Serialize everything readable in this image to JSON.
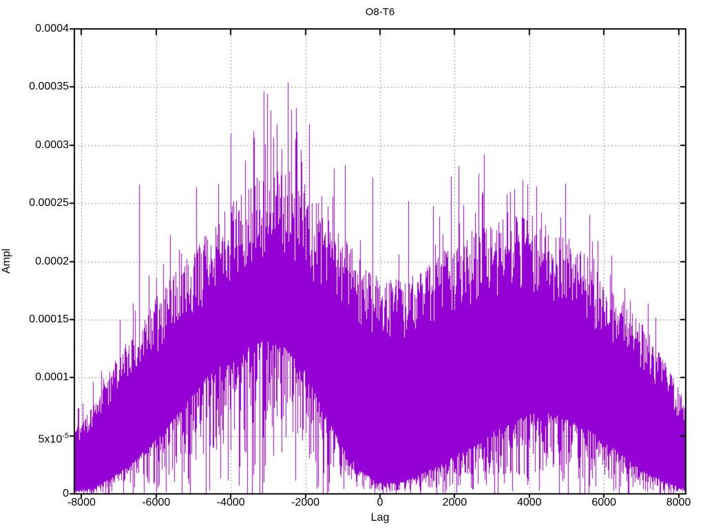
{
  "window": {
    "background": "#ffffff",
    "foreground": "#000000"
  },
  "chart_data": {
    "type": "line",
    "title": "O8-T6",
    "xlabel": "Lag",
    "ylabel": "Ampl",
    "xlim": [
      -8192,
      8192
    ],
    "ylim": [
      0,
      0.0004
    ],
    "grid": true,
    "legend": "none",
    "grid_color": "#909090",
    "axis_color": "#000000",
    "x_ticks": [
      {
        "value": -8000,
        "label": "-8000"
      },
      {
        "value": -6000,
        "label": "-6000"
      },
      {
        "value": -4000,
        "label": "-4000"
      },
      {
        "value": -2000,
        "label": "-2000"
      },
      {
        "value": 0,
        "label": "0"
      },
      {
        "value": 2000,
        "label": "2000"
      },
      {
        "value": 4000,
        "label": "4000"
      },
      {
        "value": 6000,
        "label": "6000"
      },
      {
        "value": 8000,
        "label": "8000"
      }
    ],
    "y_ticks": [
      {
        "value": 0,
        "label": "0"
      },
      {
        "value": 5e-05,
        "label": "5x10^-5"
      },
      {
        "value": 0.0001,
        "label": "0.0001"
      },
      {
        "value": 0.00015,
        "label": "0.00015"
      },
      {
        "value": 0.0002,
        "label": "0.0002"
      },
      {
        "value": 0.00025,
        "label": "0.00025"
      },
      {
        "value": 0.0003,
        "label": "0.0003"
      },
      {
        "value": 0.00035,
        "label": "0.00035"
      },
      {
        "value": 0.0004,
        "label": "0.0004"
      }
    ],
    "noise_seed": 9,
    "series": [
      {
        "name": "O8-T6",
        "color": "#9400d3",
        "style": "dense noisy oscillation; each x-pixel spans a vertical strand between lower and upper envelope; sparse taller spikes above and deep dips below",
        "envelope_lags": [
          -8192,
          -7680,
          -7168,
          -6656,
          -6144,
          -5632,
          -5120,
          -4608,
          -4096,
          -3584,
          -3072,
          -2560,
          -2048,
          -1536,
          -1024,
          -512,
          0,
          512,
          1024,
          1536,
          2048,
          2560,
          3072,
          3584,
          4096,
          4608,
          5120,
          5632,
          6144,
          6656,
          7168,
          7680,
          8192
        ],
        "envelope_upper_ampl": [
          5e-05,
          7e-05,
          0.0001,
          0.00012,
          0.000145,
          0.000165,
          0.000185,
          0.000205,
          0.00022,
          0.000235,
          0.00025,
          0.000255,
          0.000235,
          0.00022,
          0.000205,
          0.00018,
          0.000165,
          0.000165,
          0.00017,
          0.000185,
          0.000195,
          0.000205,
          0.00021,
          0.000215,
          0.000215,
          0.000205,
          0.000195,
          0.00018,
          0.000165,
          0.000145,
          0.000125,
          0.0001,
          7e-05
        ],
        "envelope_lower_ampl": [
          2e-06,
          4e-06,
          1.2e-05,
          2.2e-05,
          3.5e-05,
          5e-05,
          6.8e-05,
          8.5e-05,
          9.5e-05,
          0.000105,
          0.00011,
          0.000105,
          9e-05,
          6e-05,
          3.5e-05,
          1.6e-05,
          8e-06,
          8e-06,
          1.3e-05,
          2e-05,
          2.8e-05,
          3.5e-05,
          4.5e-05,
          5.2e-05,
          5.8e-05,
          5.8e-05,
          5.2e-05,
          4.5e-05,
          3.5e-05,
          2.5e-05,
          1.5e-05,
          8e-06,
          3e-06
        ],
        "notable_peaks": [
          {
            "lag": -6450,
            "ampl": 0.000266
          },
          {
            "lag": -4930,
            "ampl": 0.000264
          },
          {
            "lag": -4000,
            "ampl": 0.00031
          },
          {
            "lag": -3400,
            "ampl": 0.000312
          },
          {
            "lag": -3030,
            "ampl": 0.000344
          },
          {
            "lag": -2940,
            "ampl": 0.00033
          },
          {
            "lag": -2470,
            "ampl": 0.000354
          },
          {
            "lag": -2260,
            "ampl": 0.000332
          },
          {
            "lag": -1900,
            "ampl": 0.000318
          },
          {
            "lag": -1230,
            "ampl": 0.00028
          },
          {
            "lag": -950,
            "ampl": 0.000283
          },
          {
            "lag": -210,
            "ampl": 0.000272
          },
          {
            "lag": 760,
            "ampl": 0.000252
          },
          {
            "lag": 1900,
            "ampl": 0.000273
          },
          {
            "lag": 2100,
            "ampl": 0.000282
          },
          {
            "lag": 2790,
            "ampl": 0.000292
          },
          {
            "lag": 3490,
            "ampl": 0.00026
          },
          {
            "lag": 3820,
            "ampl": 0.00027
          },
          {
            "lag": 3950,
            "ampl": 0.000266
          },
          {
            "lag": 4320,
            "ampl": 0.000242
          },
          {
            "lag": 4830,
            "ampl": 0.000238
          },
          {
            "lag": 5610,
            "ampl": 0.000223
          }
        ],
        "max_point": {
          "lag": -2470,
          "ampl": 0.000354
        }
      }
    ]
  }
}
